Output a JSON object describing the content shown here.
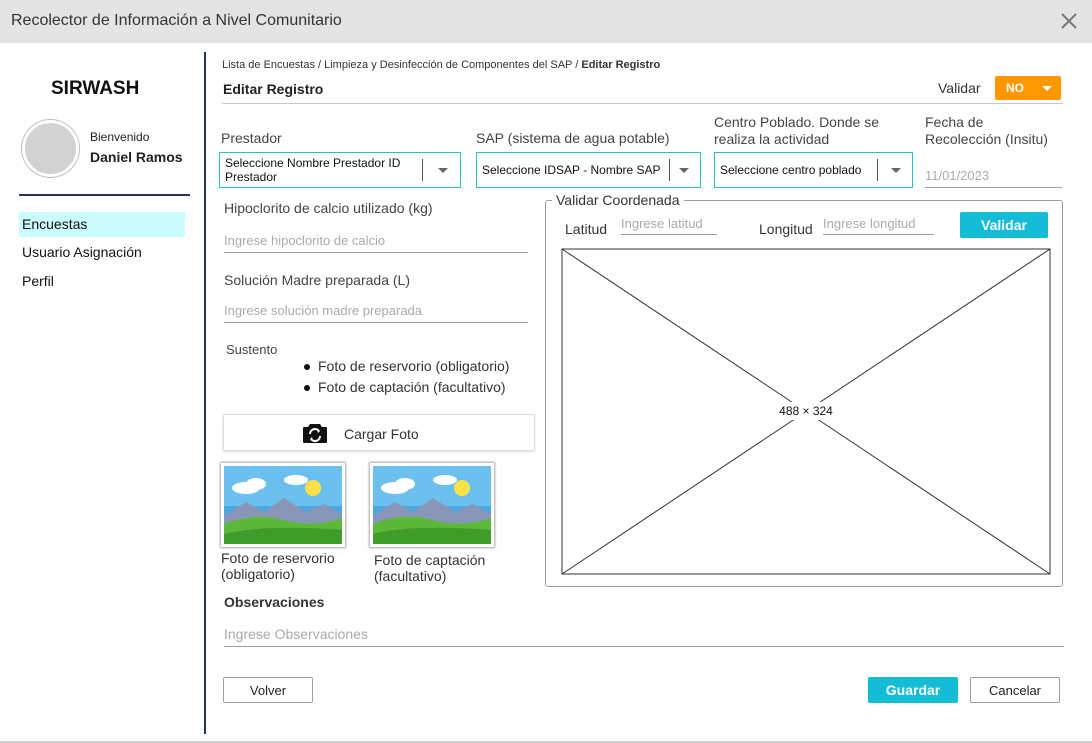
{
  "window": {
    "title": "Recolector de Información a Nivel Comunitario"
  },
  "sidebar": {
    "brand": "SIRWASH",
    "welcome": "Bienvenido",
    "user_name": "Daniel Ramos",
    "items": [
      {
        "label": "Encuestas",
        "active": true
      },
      {
        "label": "Usuario Asignación",
        "active": false
      },
      {
        "label": "Perfil",
        "active": false
      }
    ]
  },
  "header": {
    "breadcrumb": [
      "Lista de Encuestas",
      "Limpieza y Desinfección de Componentes del SAP"
    ],
    "breadcrumb_current": "Editar Registro",
    "page_title": "Editar Registro",
    "validar_label": "Validar",
    "validar_value": "NO"
  },
  "form": {
    "prestador": {
      "label": "Prestador",
      "value": "Seleccione Nombre Prestador  ID Prestador"
    },
    "sap": {
      "label": "SAP (sistema de agua potable)",
      "value": "Seleccione IDSAP - Nombre SAP"
    },
    "centro": {
      "label": "Centro Poblado. Donde se realiza la actividad",
      "value": "Seleccione centro poblado"
    },
    "fecha": {
      "label": "Fecha de Recolección (Insitu)",
      "placeholder": "11/01/2023"
    },
    "hipoclorito": {
      "label": "Hipoclorito de calcio utilizado (kg)",
      "placeholder": "Ingrese hipoclorito de calcio"
    },
    "solucion": {
      "label": "Solución Madre preparada (L)",
      "placeholder": "Ingrese solución madre preparada"
    },
    "sustento": {
      "label": "Sustento",
      "items": [
        "Foto de reservorio (obligatorio)",
        "Foto de captación (facultativo)"
      ]
    },
    "cargar_foto": "Cargar Foto",
    "photos": [
      {
        "caption": "Foto de reservorio (obligatorio)"
      },
      {
        "caption": "Foto de captación (facultativo)"
      }
    ],
    "observaciones": {
      "label": "Observaciones",
      "placeholder": "Ingrese Observaciones"
    }
  },
  "coords": {
    "legend": "Validar Coordenada",
    "lat_label": "Latitud",
    "lat_placeholder": "Ingrese latitud",
    "lon_label": "Longitud",
    "lon_placeholder": "Ingrese longitud",
    "validar_button": "Validar",
    "map_placeholder_text": "488 × 324"
  },
  "footer": {
    "volver": "Volver",
    "guardar": "Guardar",
    "cancelar": "Cancelar"
  },
  "colors": {
    "accent": "#14bcd6",
    "orange": "#ff9800",
    "navy": "#27306b",
    "active_nav": "#ccfbfd"
  }
}
